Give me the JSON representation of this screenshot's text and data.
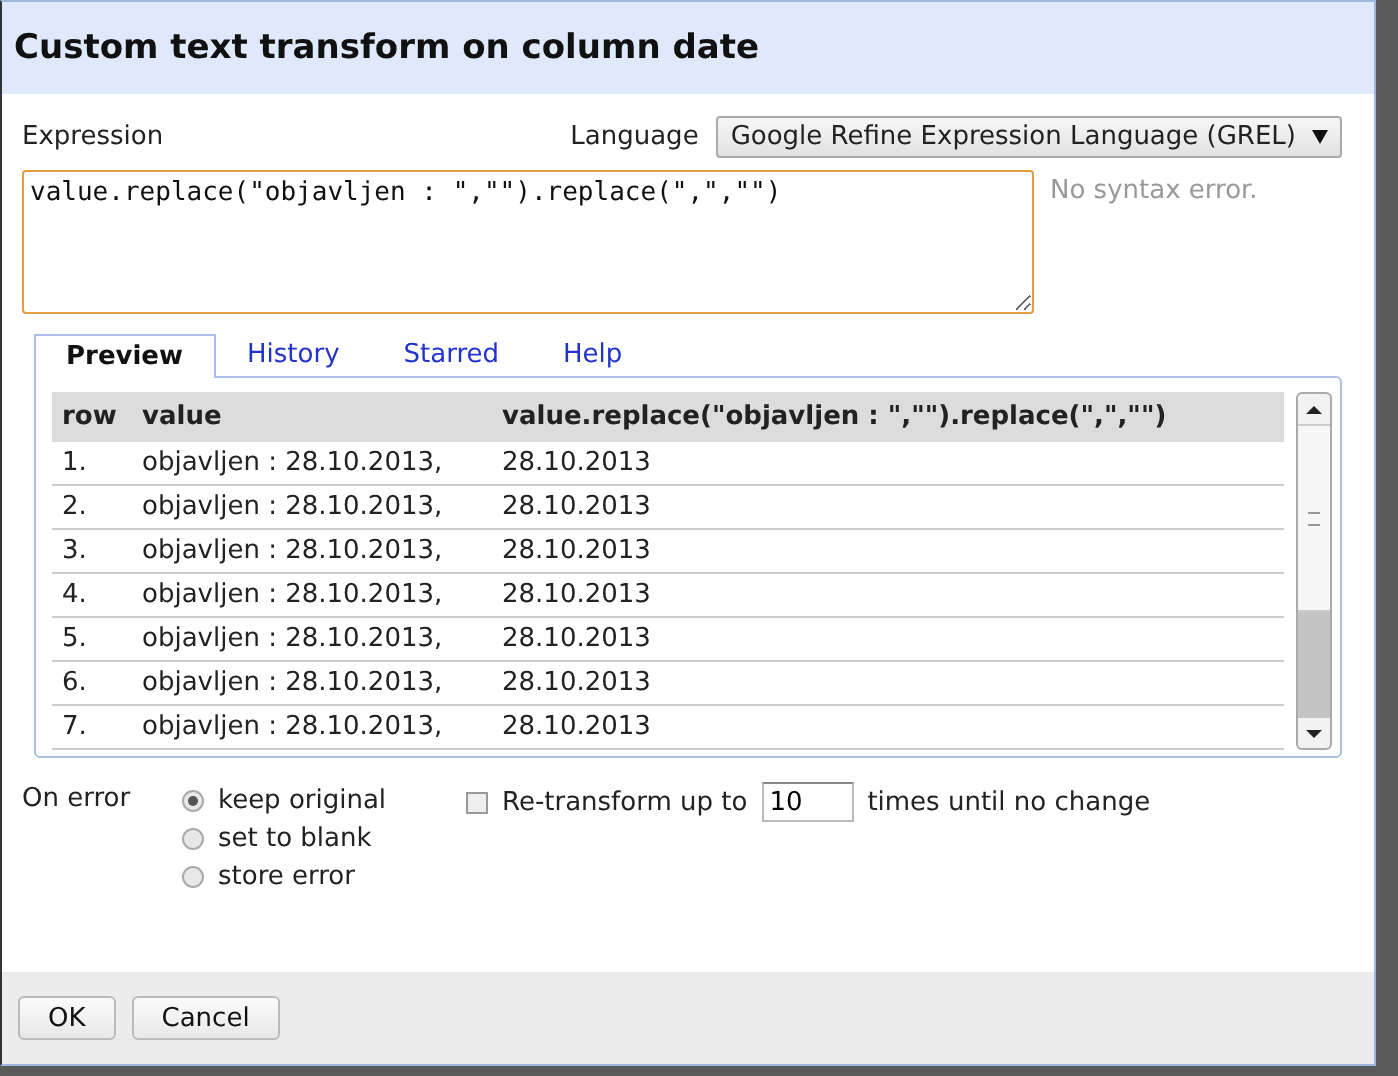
{
  "dialog": {
    "title": "Custom text transform on column date"
  },
  "expression": {
    "label": "Expression",
    "value": "value.replace(\"objavljen : \",\"\").replace(\",\",\"\")",
    "status": "No syntax error."
  },
  "language": {
    "label": "Language",
    "value": "Google Refine Expression Language (GREL)"
  },
  "tabs": [
    {
      "label": "Preview",
      "selected": true
    },
    {
      "label": "History",
      "selected": false
    },
    {
      "label": "Starred",
      "selected": false
    },
    {
      "label": "Help",
      "selected": false
    }
  ],
  "preview": {
    "columns": [
      "row",
      "value",
      "value.replace(\"objavljen : \",\"\").replace(\",\",\"\")"
    ],
    "rows": [
      [
        "1.",
        "objavljen : 28.10.2013,",
        "28.10.2013"
      ],
      [
        "2.",
        "objavljen : 28.10.2013,",
        "28.10.2013"
      ],
      [
        "3.",
        "objavljen : 28.10.2013,",
        "28.10.2013"
      ],
      [
        "4.",
        "objavljen : 28.10.2013,",
        "28.10.2013"
      ],
      [
        "5.",
        "objavljen : 28.10.2013,",
        "28.10.2013"
      ],
      [
        "6.",
        "objavljen : 28.10.2013,",
        "28.10.2013"
      ],
      [
        "7.",
        "objavljen : 28.10.2013,",
        "28.10.2013"
      ]
    ]
  },
  "on_error": {
    "label": "On error",
    "options": [
      {
        "label": "keep original",
        "selected": true
      },
      {
        "label": "set to blank",
        "selected": false
      },
      {
        "label": "store error",
        "selected": false
      }
    ]
  },
  "retransform": {
    "checked": false,
    "prefix": "Re-transform up to",
    "value": "10",
    "suffix": "times until no change"
  },
  "buttons": [
    "OK",
    "Cancel"
  ]
}
